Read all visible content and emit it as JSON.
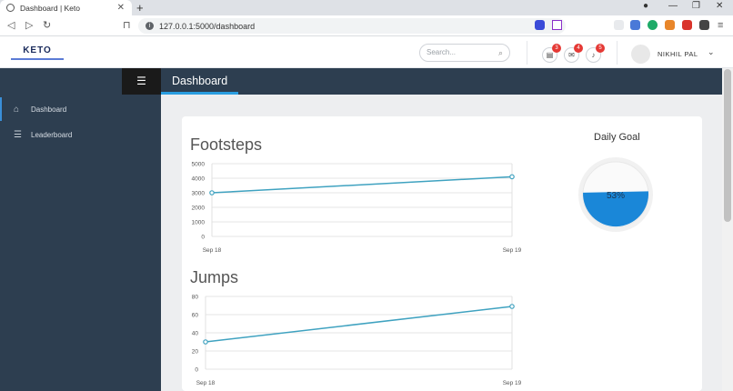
{
  "browser": {
    "tab_title": "Dashboard | Keto",
    "url": "127.0.0.1:5000/dashboard"
  },
  "topbar": {
    "logo_text": "KETO",
    "search_placeholder": "Search...",
    "notifications": [
      {
        "icon": "message-icon",
        "count": "3"
      },
      {
        "icon": "envelope-icon",
        "count": "4"
      },
      {
        "icon": "bell-icon",
        "count": "5"
      }
    ],
    "user_name": "NIKHIL PAL"
  },
  "sidebar": {
    "items": [
      {
        "label": "Dashboard",
        "icon": "home-icon"
      },
      {
        "label": "Leaderboard",
        "icon": "list-icon"
      }
    ]
  },
  "header": {
    "title": "Dashboard"
  },
  "footsteps": {
    "title": "Footsteps"
  },
  "jumps": {
    "title": "Jumps"
  },
  "goal": {
    "title": "Daily Goal",
    "percent_label": "53%",
    "percent": 53
  },
  "chart_data": [
    {
      "type": "line",
      "title": "Footsteps",
      "x": [
        "Sep 18",
        "Sep 19"
      ],
      "series": [
        {
          "values": [
            3000,
            4100
          ]
        }
      ],
      "ylim": [
        0,
        5000
      ],
      "yticks": [
        0,
        1000,
        2000,
        3000,
        4000,
        5000
      ]
    },
    {
      "type": "line",
      "title": "Jumps",
      "x": [
        "Sep 18",
        "Sep 19"
      ],
      "series": [
        {
          "values": [
            30,
            69
          ]
        }
      ],
      "ylim": [
        0,
        80
      ],
      "yticks": [
        0,
        20,
        40,
        60,
        80
      ]
    }
  ],
  "colors": {
    "accent": "#2a9de0",
    "line": "#3fa2c0",
    "goal_fill": "#1a87d8",
    "sidebar": "#2d3e50"
  }
}
